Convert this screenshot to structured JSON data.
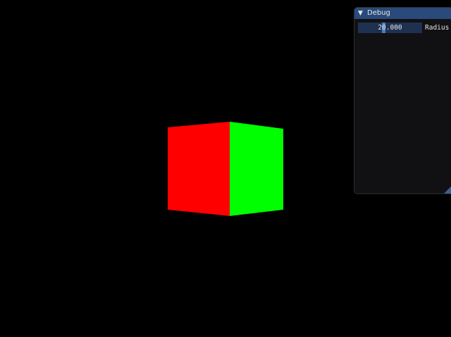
{
  "scene": {
    "background_color": "#000000",
    "cube": {
      "left_face_color": "#ff0000",
      "right_face_color": "#00ff00"
    }
  },
  "debug_window": {
    "title": "Debug",
    "collapse_icon": "triangle-down-icon",
    "title_bar_color": "#294a7a",
    "radius_slider": {
      "value": "20.000",
      "label": "Radius",
      "grab_fraction": 0.4
    },
    "resize_icon": "resize-grip-icon"
  }
}
